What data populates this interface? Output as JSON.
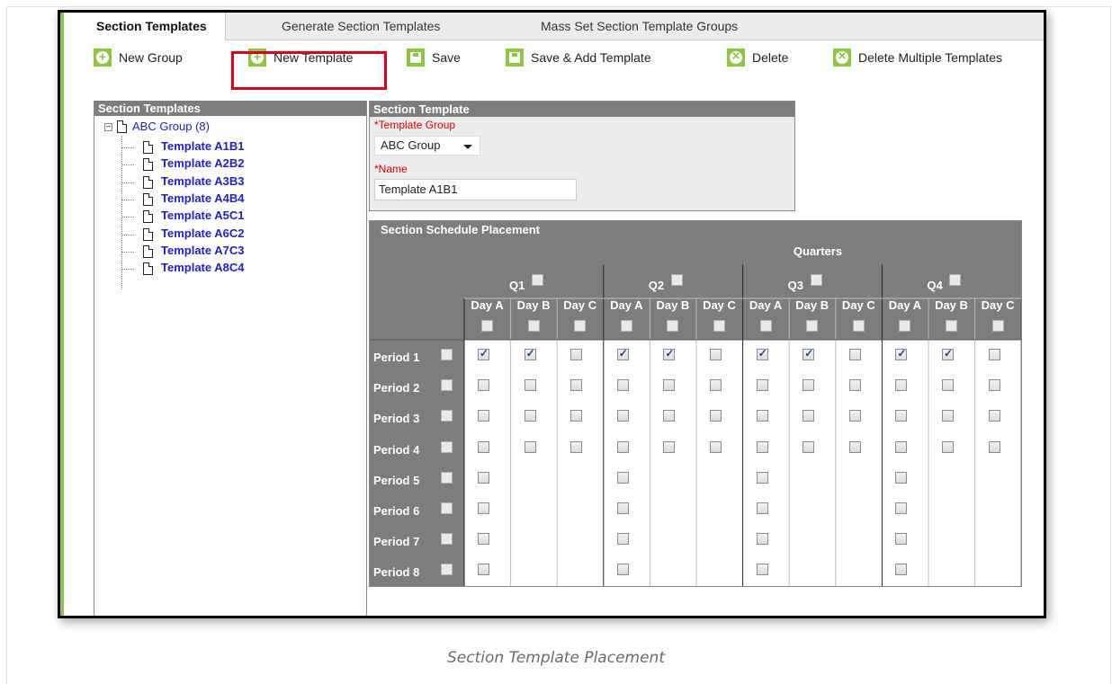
{
  "tabs": [
    {
      "label": "Section Templates",
      "active": true
    },
    {
      "label": "Generate Section Templates",
      "active": false
    },
    {
      "label": "Mass Set Section Template Groups",
      "active": false
    }
  ],
  "toolbar": {
    "new_group": "New Group",
    "new_template": "New Template",
    "save": "Save",
    "save_add": "Save & Add Template",
    "delete": "Delete",
    "delete_multiple": "Delete Multiple Templates"
  },
  "colors": {
    "accent_green": "#8dc640",
    "header_gray": "#7d7d7d",
    "highlight_red": "#e3001b",
    "link_blue": "#2020d0"
  },
  "tree": {
    "header": "Section Templates",
    "group_label": "ABC Group (8)",
    "items": [
      "Template A1B1",
      "Template A2B2",
      "Template A3B3",
      "Template A4B4",
      "Template A5C1",
      "Template A6C2",
      "Template A7C3",
      "Template A8C4"
    ]
  },
  "form": {
    "header": "Section Template",
    "group_label": "*Template Group",
    "group_value": "ABC Group",
    "name_label": "*Name",
    "name_value": "Template A1B1"
  },
  "schedule": {
    "title": "Section Schedule Placement",
    "term_title": "Quarters",
    "quarters": [
      "Q1",
      "Q2",
      "Q3",
      "Q4"
    ],
    "days": [
      "Day A",
      "Day B",
      "Day C"
    ],
    "periods": [
      "Period 1",
      "Period 2",
      "Period 3",
      "Period 4",
      "Period 5",
      "Period 6",
      "Period 7",
      "Period 8"
    ],
    "checked": [
      [
        true,
        true,
        false,
        true,
        true,
        false,
        true,
        true,
        false,
        true,
        true,
        false
      ],
      [
        false,
        false,
        false,
        false,
        false,
        false,
        false,
        false,
        false,
        false,
        false,
        false
      ],
      [
        false,
        false,
        false,
        false,
        false,
        false,
        false,
        false,
        false,
        false,
        false,
        false
      ],
      [
        false,
        false,
        false,
        false,
        false,
        false,
        false,
        false,
        false,
        false,
        false,
        false
      ],
      [
        false,
        null,
        null,
        false,
        null,
        null,
        false,
        null,
        null,
        false,
        null,
        null
      ],
      [
        false,
        null,
        null,
        false,
        null,
        null,
        false,
        null,
        null,
        false,
        null,
        null
      ],
      [
        false,
        null,
        null,
        false,
        null,
        null,
        false,
        null,
        null,
        false,
        null,
        null
      ],
      [
        false,
        null,
        null,
        false,
        null,
        null,
        false,
        null,
        null,
        false,
        null,
        null
      ]
    ]
  },
  "caption": "Section Template Placement"
}
